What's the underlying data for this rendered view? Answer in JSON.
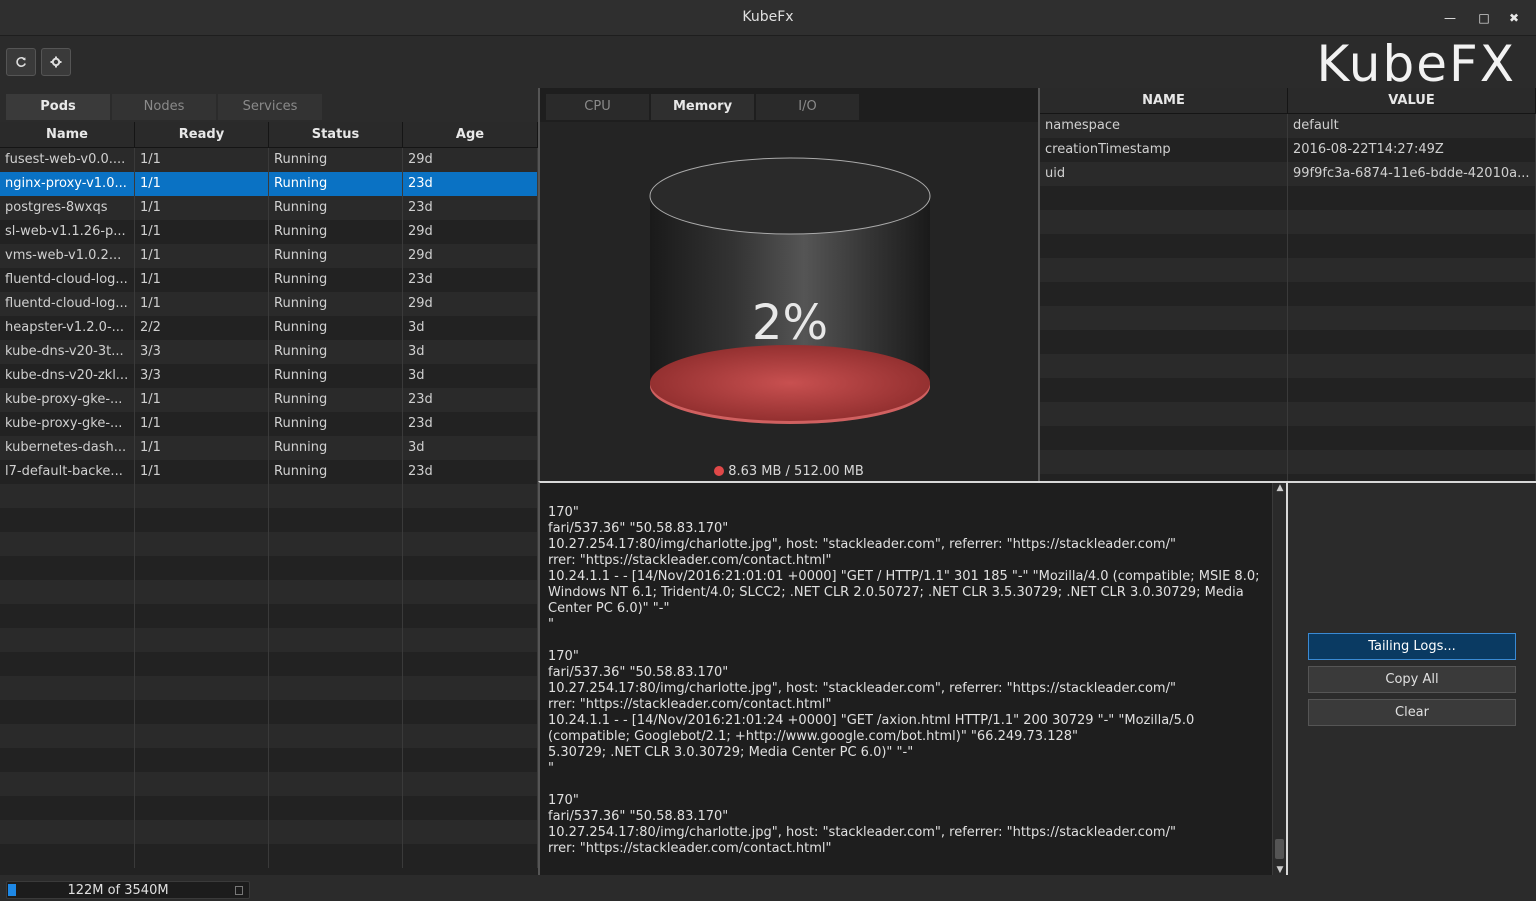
{
  "window": {
    "title": "KubeFx",
    "minimize": "—",
    "maximize": "□",
    "close": "✖"
  },
  "toolbar": {
    "logo": "KubeFX",
    "icons": [
      "refresh-icon",
      "settings-icon"
    ]
  },
  "left_tabs": [
    {
      "label": "Pods",
      "active": true
    },
    {
      "label": "Nodes"
    },
    {
      "label": "Services"
    }
  ],
  "pods_table": {
    "columns": [
      "Name",
      "Ready",
      "Status",
      "Age"
    ],
    "rows": [
      [
        "fusest-web-v0.0....",
        "1/1",
        "Running",
        "29d"
      ],
      [
        "nginx-proxy-v1.0...",
        "1/1",
        "Running",
        "23d"
      ],
      [
        "postgres-8wxqs",
        "1/1",
        "Running",
        "23d"
      ],
      [
        "sl-web-v1.1.26-p...",
        "1/1",
        "Running",
        "29d"
      ],
      [
        "vms-web-v1.0.2...",
        "1/1",
        "Running",
        "29d"
      ],
      [
        "fluentd-cloud-log...",
        "1/1",
        "Running",
        "23d"
      ],
      [
        "fluentd-cloud-log...",
        "1/1",
        "Running",
        "29d"
      ],
      [
        "heapster-v1.2.0-...",
        "2/2",
        "Running",
        "3d"
      ],
      [
        "kube-dns-v20-3t...",
        "3/3",
        "Running",
        "3d"
      ],
      [
        "kube-dns-v20-zkl...",
        "3/3",
        "Running",
        "3d"
      ],
      [
        "kube-proxy-gke-...",
        "1/1",
        "Running",
        "23d"
      ],
      [
        "kube-proxy-gke-...",
        "1/1",
        "Running",
        "23d"
      ],
      [
        "kubernetes-dash...",
        "1/1",
        "Running",
        "3d"
      ],
      [
        "l7-default-backe...",
        "1/1",
        "Running",
        "23d"
      ]
    ],
    "selected_index": 1
  },
  "metric_tabs": [
    {
      "label": "CPU"
    },
    {
      "label": "Memory",
      "active": true
    },
    {
      "label": "I/O"
    }
  ],
  "gauge": {
    "percent": 2,
    "label": "2%",
    "legend": "8.63 MB / 512.00 MB",
    "fill_color": "#e04848"
  },
  "properties": {
    "columns": [
      "NAME",
      "VALUE"
    ],
    "rows": [
      [
        "namespace",
        "default"
      ],
      [
        "creationTimestamp",
        "2016-08-22T14:27:49Z"
      ],
      [
        "uid",
        "99f9fc3a-6874-11e6-bdde-42010a..."
      ]
    ]
  },
  "logs": {
    "text": "170\"\nfari/537.36\" \"50.58.83.170\"\n10.27.254.17:80/img/charlotte.jpg\", host: \"stackleader.com\", referrer: \"https://stackleader.com/\"\nrrer: \"https://stackleader.com/contact.html\"\n10.24.1.1 - - [14/Nov/2016:21:01:01 +0000] \"GET / HTTP/1.1\" 301 185 \"-\" \"Mozilla/4.0 (compatible; MSIE 8.0; Windows NT 6.1; Trident/4.0; SLCC2; .NET CLR 2.0.50727; .NET CLR 3.5.30729; .NET CLR 3.0.30729; Media Center PC 6.0)\" \"-\"\n\"\n\n170\"\nfari/537.36\" \"50.58.83.170\"\n10.27.254.17:80/img/charlotte.jpg\", host: \"stackleader.com\", referrer: \"https://stackleader.com/\"\nrrer: \"https://stackleader.com/contact.html\"\n10.24.1.1 - - [14/Nov/2016:21:01:24 +0000] \"GET /axion.html HTTP/1.1\" 200 30729 \"-\" \"Mozilla/5.0 (compatible; Googlebot/2.1; +http://www.google.com/bot.html)\" \"66.249.73.128\"\n5.30729; .NET CLR 3.0.30729; Media Center PC 6.0)\" \"-\"\n\"\n\n170\"\nfari/537.36\" \"50.58.83.170\"\n10.27.254.17:80/img/charlotte.jpg\", host: \"stackleader.com\", referrer: \"https://stackleader.com/\"\nrrer: \"https://stackleader.com/contact.html\""
  },
  "log_buttons": {
    "tailing": "Tailing Logs...",
    "copy": "Copy All",
    "clear": "Clear"
  },
  "status": {
    "memory": "122M of 3540M",
    "memory_fraction": 0.034
  }
}
